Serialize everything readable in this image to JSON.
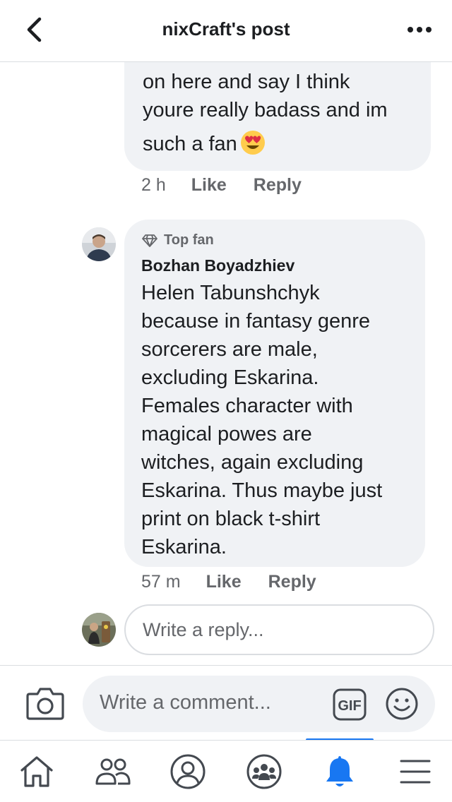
{
  "header": {
    "title": "nixCraft's post",
    "back_icon": "chevron-left-icon",
    "more_icon": "more-dots-icon"
  },
  "comments": [
    {
      "text_lines": [
        "on here and say I think",
        "youre really badass and im",
        "such a fan"
      ],
      "emoji": "heart-eyes-emoji",
      "time": "2 h",
      "like_label": "Like",
      "reply_label": "Reply"
    },
    {
      "badge": "Top fan",
      "author": "Bozhan Boyadzhiev",
      "text_lines": [
        "Helen Tabunshchyk",
        "because in fantasy genre",
        "sorcerers are male,",
        "excluding Eskarina.",
        "Females character with",
        "magical powes are",
        "witches, again excluding",
        "Eskarina. Thus maybe just",
        "print on black t-shirt",
        "Eskarina."
      ],
      "time": "57 m",
      "like_label": "Like",
      "reply_label": "Reply"
    }
  ],
  "reply_box": {
    "placeholder": "Write a reply..."
  },
  "composer": {
    "placeholder": "Write a comment...",
    "gif_label": "GIF"
  },
  "tabbar": {
    "tabs": [
      "home",
      "friends",
      "profile",
      "groups",
      "notifications",
      "menu"
    ],
    "active": "notifications"
  },
  "colors": {
    "accent": "#1877f2",
    "bubble": "#f0f2f5",
    "muted": "#65676b"
  }
}
